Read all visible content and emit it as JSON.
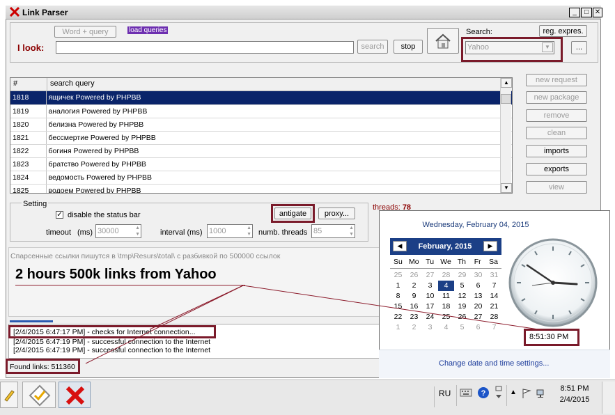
{
  "window": {
    "title": "Link Parser"
  },
  "toolbar": {
    "i_look_label": "I look:",
    "word_query_label": "Word + query",
    "load_queries_label": "load queries",
    "search_label": "search",
    "stop_label": "stop",
    "search_engine_label": "Search:",
    "search_engine_value": "Yahoo",
    "regex_label": "reg. expres.",
    "more_label": "...",
    "query_input_value": ""
  },
  "table": {
    "columns": [
      "#",
      "search query"
    ],
    "rows": [
      {
        "num": "1818",
        "query": "ящичек Powered by PHPBB"
      },
      {
        "num": "1819",
        "query": "аналогия Powered by PHPBB"
      },
      {
        "num": "1820",
        "query": "белизна Powered by PHPBB"
      },
      {
        "num": "1821",
        "query": "бессмертие Powered by PHPBB"
      },
      {
        "num": "1822",
        "query": "богиня Powered by PHPBB"
      },
      {
        "num": "1823",
        "query": "братство Powered by PHPBB"
      },
      {
        "num": "1824",
        "query": "ведомость Powered by PHPBB"
      },
      {
        "num": "1825",
        "query": "водоем Powered by PHPBB"
      }
    ]
  },
  "side_buttons": {
    "new_request": "new request",
    "new_package": "new package",
    "remove": "remove",
    "clean": "clean",
    "imports": "imports",
    "exports": "exports",
    "view": "view"
  },
  "settings": {
    "group_label": "Setting",
    "disable_status_bar": "disable the status bar",
    "antigate": "antigate",
    "proxy": "proxy...",
    "timeout_label": "timeout",
    "timeout_unit": "(ms)",
    "timeout_value": "30000",
    "interval_label": "interval (ms)",
    "interval_value": "1000",
    "threads_label": "numb. threads",
    "threads_value": "85",
    "threads_status_label": "threads:",
    "threads_status_value": "78"
  },
  "info": {
    "path_note": "Спарсенные ссылки пишутся в \\tmp\\Resurs\\total\\ с разбивкой по 500000 ссылок",
    "annotation": "2 hours 500k links from Yahoo"
  },
  "log": [
    "[2/4/2015 6:47:17 PM] - checks for Internet connection...",
    "[2/4/2015 6:47:19 PM] - successful connection to the Internet",
    "[2/4/2015 6:47:19 PM] - successful connection to the Internet"
  ],
  "status": {
    "found_links": "Found links: 511360"
  },
  "calendar": {
    "long_date": "Wednesday, February 04, 2015",
    "month_label": "February, 2015",
    "weekdays": [
      "Su",
      "Mo",
      "Tu",
      "We",
      "Th",
      "Fr",
      "Sa"
    ],
    "weeks": [
      [
        "25",
        "26",
        "27",
        "28",
        "29",
        "30",
        "31"
      ],
      [
        "1",
        "2",
        "3",
        "4",
        "5",
        "6",
        "7"
      ],
      [
        "8",
        "9",
        "10",
        "11",
        "12",
        "13",
        "14"
      ],
      [
        "15",
        "16",
        "17",
        "18",
        "19",
        "20",
        "21"
      ],
      [
        "22",
        "23",
        "24",
        "25",
        "26",
        "27",
        "28"
      ],
      [
        "1",
        "2",
        "3",
        "4",
        "5",
        "6",
        "7"
      ]
    ],
    "time": "8:51:30 PM",
    "settings_link": "Change date and time settings..."
  },
  "taskbar": {
    "lang": "RU",
    "clock_time": "8:51 PM",
    "clock_date": "2/4/2015"
  }
}
